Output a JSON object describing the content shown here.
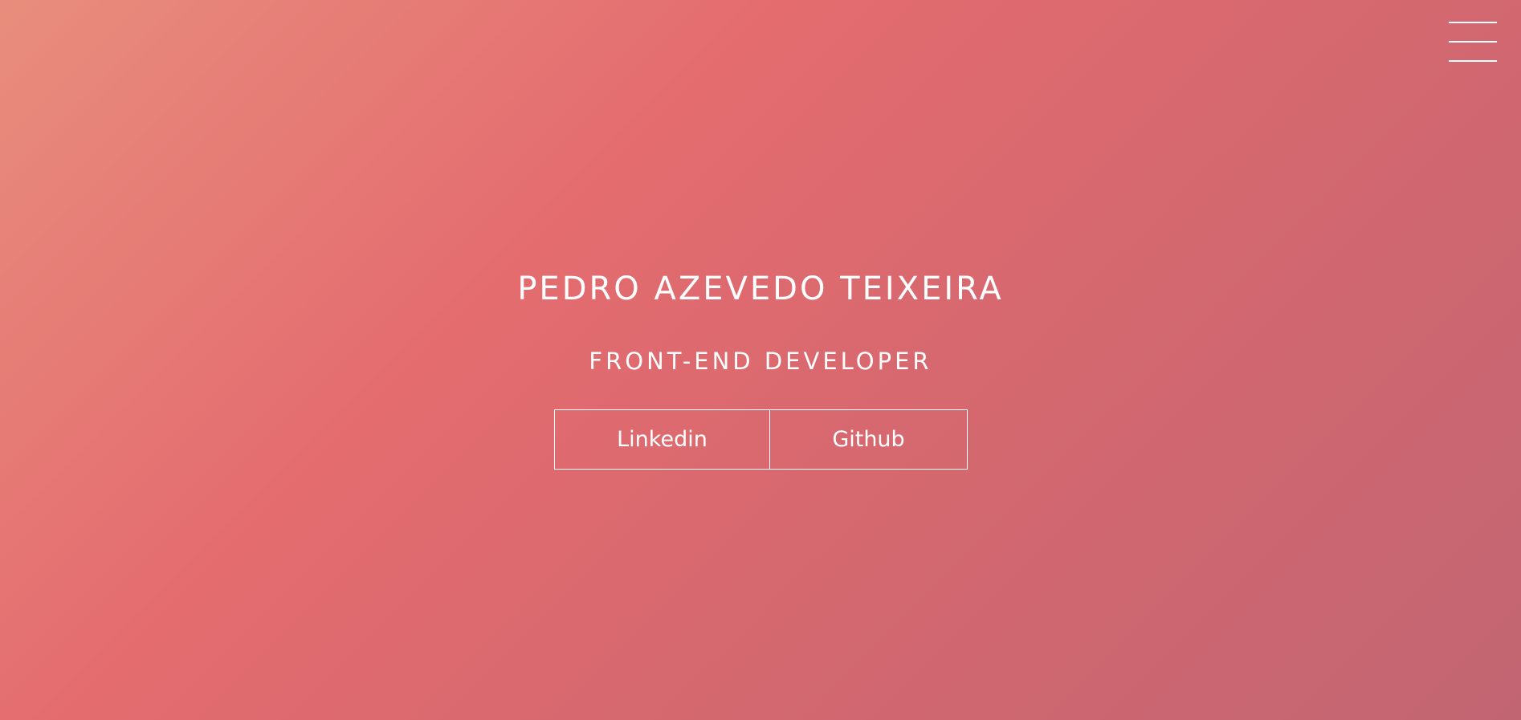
{
  "menu": {
    "icon": "hamburger-menu-icon"
  },
  "hero": {
    "name": "PEDRO AZEVEDO TEIXEIRA",
    "role": "FRONT-END DEVELOPER",
    "buttons": {
      "linkedin": "Linkedin",
      "github": "Github"
    }
  },
  "colors": {
    "gradient_start": "#e88d7d",
    "gradient_mid": "#e46c6f",
    "gradient_end": "#c26572",
    "text": "#ffffff"
  }
}
